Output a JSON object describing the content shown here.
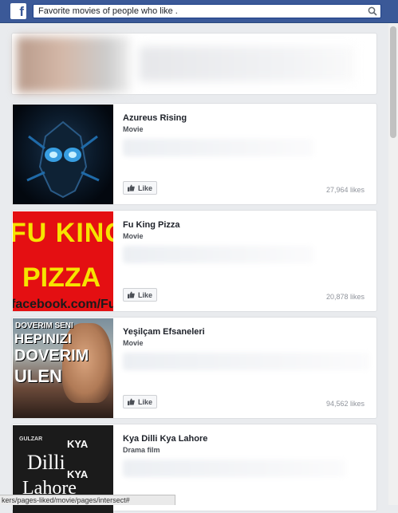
{
  "search": {
    "value": "Favorite movies of people who like ."
  },
  "results": [
    {
      "title": "Azureus Rising",
      "category": "Movie",
      "like_label": "Like",
      "likes": "27,964 likes"
    },
    {
      "title": "Fu King Pizza",
      "category": "Movie",
      "like_label": "Like",
      "likes": "20,878 likes",
      "poster_text": [
        "FU KING",
        "PIZZA",
        "facebook.com/FuKing"
      ]
    },
    {
      "title": "Yeşilçam Efsaneleri",
      "category": "Movie",
      "like_label": "Like",
      "likes": "94,562 likes",
      "poster_text": [
        "DOVERIM SENI",
        "HEPINIZI",
        "DOVERIM",
        "ULEN"
      ]
    },
    {
      "title": "Kya Dilli Kya Lahore",
      "category": "Drama film",
      "poster_text": [
        "GULZAR",
        "KYA",
        "Dilli",
        "KYA",
        "Lahore"
      ]
    }
  ],
  "status_bar": {
    "url": "kers/pages-liked/movie/pages/intersect#"
  }
}
